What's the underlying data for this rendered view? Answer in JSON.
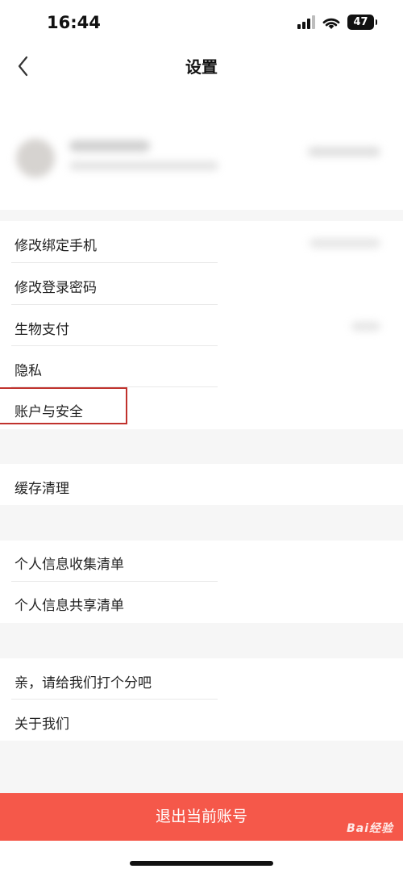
{
  "status_bar": {
    "time": "16:44",
    "battery": "47"
  },
  "nav": {
    "title": "设置"
  },
  "groups": {
    "account": [
      {
        "label": "修改绑定手机"
      },
      {
        "label": "修改登录密码"
      },
      {
        "label": "生物支付"
      },
      {
        "label": "隐私"
      },
      {
        "label": "账户与安全"
      }
    ],
    "cache": [
      {
        "label": "缓存清理"
      }
    ],
    "privacy_lists": [
      {
        "label": "个人信息收集清单"
      },
      {
        "label": "个人信息共享清单"
      }
    ],
    "about": [
      {
        "label": "亲，请给我们打个分吧"
      },
      {
        "label": "关于我们"
      }
    ]
  },
  "footer": {
    "logout_label": "退出当前账号"
  },
  "watermark": {
    "text": "Bai经验"
  },
  "colors": {
    "accent": "#f5584a",
    "highlight": "#c0322d"
  }
}
